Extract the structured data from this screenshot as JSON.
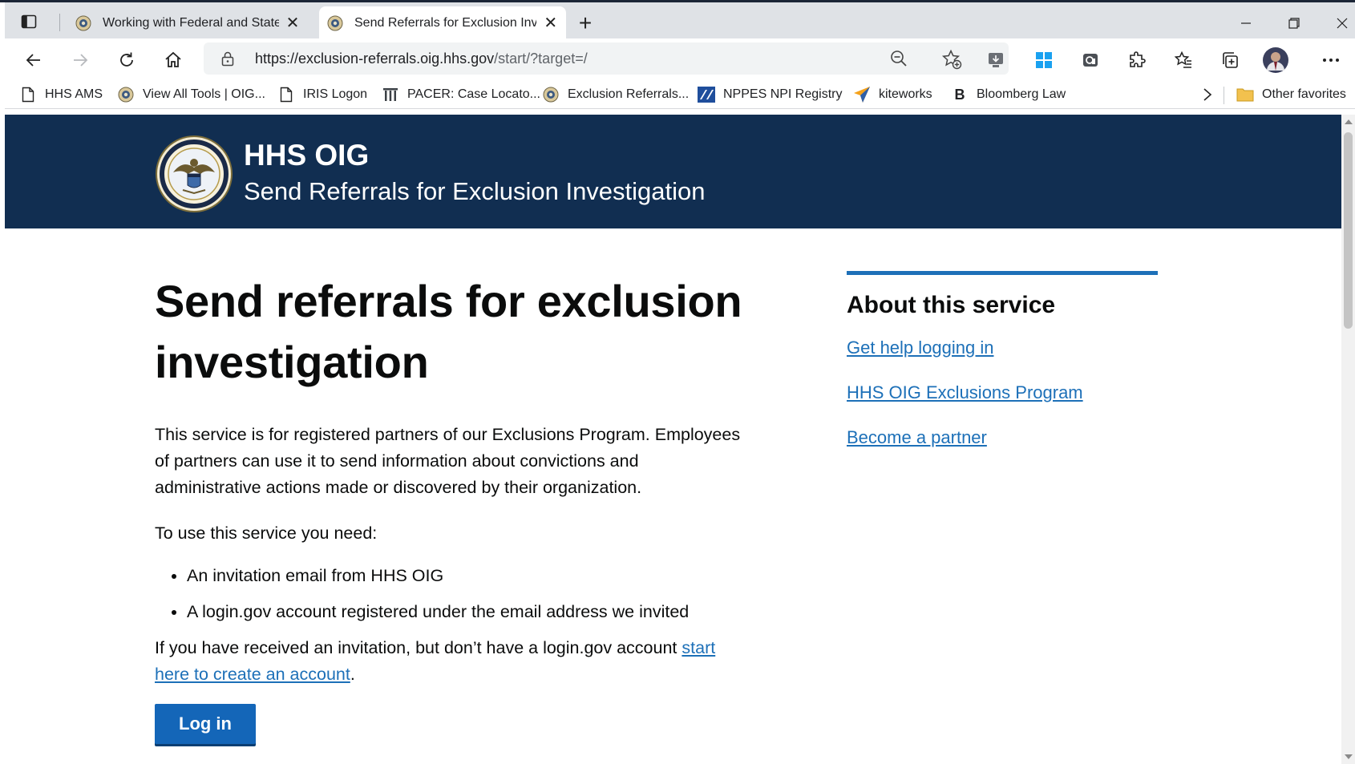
{
  "browser": {
    "tabs": [
      {
        "title": "Working with Federal and State P",
        "active": false
      },
      {
        "title": "Send Referrals for Exclusion Inve",
        "active": true
      }
    ],
    "url_host": "https://exclusion-referrals.oig.hhs.gov",
    "url_path": "/start/?target=/",
    "favorites": [
      {
        "label": "HHS AMS",
        "icon": "page-icon"
      },
      {
        "label": "View All Tools | OIG...",
        "icon": "seal-icon"
      },
      {
        "label": "IRIS Logon",
        "icon": "page-icon"
      },
      {
        "label": "PACER: Case Locato...",
        "icon": "columns-icon"
      },
      {
        "label": "Exclusion Referrals...",
        "icon": "seal-icon"
      },
      {
        "label": "NPPES NPI Registry",
        "icon": "cms-icon"
      },
      {
        "label": "kiteworks",
        "icon": "kite-icon"
      },
      {
        "label": "Bloomberg Law",
        "icon": "b-icon"
      }
    ],
    "other_favorites": "Other favorites"
  },
  "header": {
    "title": "HHS OIG",
    "subtitle": "Send Referrals for Exclusion Investigation"
  },
  "main": {
    "heading": "Send referrals for exclusion investigation",
    "intro": "This service is for registered partners of our Exclusions Program. Employees of partners can use it to send information about convictions and administrative actions made or discovered by their organization.",
    "need_label": "To use this service you need:",
    "needs": [
      "An invitation email from HHS OIG",
      "A login.gov account registered under the email address we invited"
    ],
    "invite_text": "If you have received an invitation, but don’t have a login.gov account ",
    "invite_link": "start here to create an account",
    "invite_end": ".",
    "login_button": "Log in"
  },
  "aside": {
    "heading": "About this service",
    "links": [
      "Get help logging in",
      "HHS OIG Exclusions Program",
      "Become a partner"
    ]
  },
  "colors": {
    "header_bg": "#112e51",
    "link": "#1d70b8",
    "button": "#1466b8",
    "aside_rule": "#1d70b8"
  }
}
